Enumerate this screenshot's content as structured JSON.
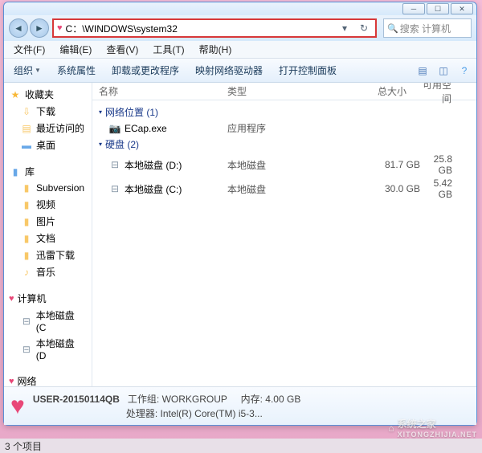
{
  "address": "C：\\WINDOWS\\system32",
  "search_placeholder": "搜索 计算机",
  "menus": [
    "文件(F)",
    "编辑(E)",
    "查看(V)",
    "工具(T)",
    "帮助(H)"
  ],
  "toolbar": {
    "organize": "组织",
    "props": "系统属性",
    "uninstall": "卸载或更改程序",
    "mapdrive": "映射网络驱动器",
    "controlpanel": "打开控制面板"
  },
  "sidebar": {
    "favorites": {
      "label": "收藏夹",
      "items": [
        "下载",
        "最近访问的",
        "桌面"
      ]
    },
    "libraries": {
      "label": "库",
      "items": [
        "Subversion",
        "视频",
        "图片",
        "文档",
        "迅雷下载",
        "音乐"
      ]
    },
    "computer": {
      "label": "计算机",
      "items": [
        "本地磁盘 (C",
        "本地磁盘 (D"
      ]
    },
    "network": {
      "label": "网络"
    }
  },
  "columns": {
    "name": "名称",
    "type": "类型",
    "totalsize": "总大小",
    "freespace": "可用空间"
  },
  "groups": [
    {
      "title": "网络位置 (1)",
      "items": [
        {
          "icon": "camera",
          "name": "ECap.exe",
          "type": "应用程序",
          "size": "",
          "free": ""
        }
      ]
    },
    {
      "title": "硬盘 (2)",
      "items": [
        {
          "icon": "drive",
          "name": "本地磁盘 (D:)",
          "type": "本地磁盘",
          "size": "81.7 GB",
          "free": "25.8 GB"
        },
        {
          "icon": "drive",
          "name": "本地磁盘 (C:)",
          "type": "本地磁盘",
          "size": "30.0 GB",
          "free": "5.42 GB"
        }
      ]
    }
  ],
  "details": {
    "name": "USER-20150114QB",
    "workgroup_label": "工作组:",
    "workgroup": "WORKGROUP",
    "memory_label": "内存:",
    "memory": "4.00 GB",
    "cpu_label": "处理器:",
    "cpu": "Intel(R) Core(TM) i5-3..."
  },
  "status": "3 个项目",
  "watermark": {
    "text": "系统之家",
    "url": "XITONGZHIJIA.NET"
  }
}
